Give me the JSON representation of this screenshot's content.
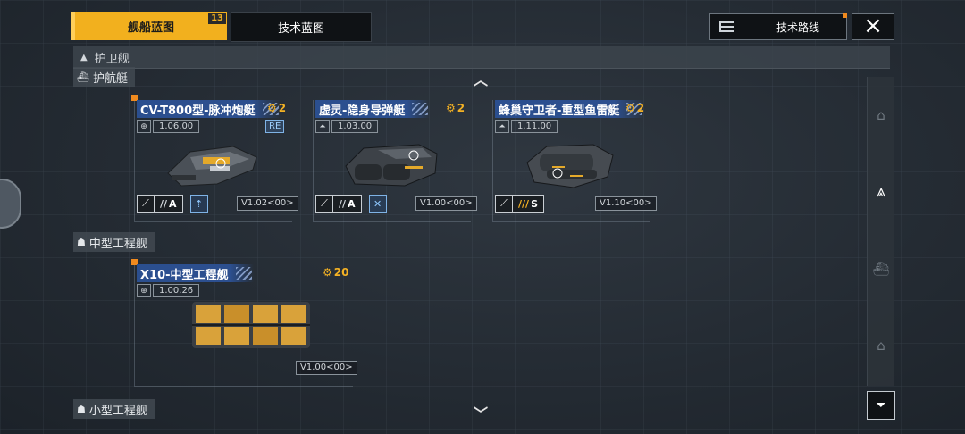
{
  "tabs": {
    "ship_blueprint": "舰船蓝图",
    "ship_blueprint_badge": "13",
    "tech_blueprint": "技术蓝图"
  },
  "top_right": {
    "tech_route": "技术路线",
    "close_icon": "×"
  },
  "category": {
    "title": "护卫舰"
  },
  "subcategories": {
    "escort": "护航艇",
    "medium_engineering": "中型工程舰",
    "small_engineering": "小型工程舰"
  },
  "ships": [
    {
      "name": "CV-T800型-脉冲炮艇",
      "cost": "2",
      "version": "1.06.00",
      "badge": "RE",
      "grade_prefix": "//",
      "grade": "A",
      "vtag": "V1.02<00>"
    },
    {
      "name": "虚灵-隐身导弹艇",
      "cost": "2",
      "version": "1.03.00",
      "grade_prefix": "//",
      "grade": "A",
      "vtag": "V1.00<00>"
    },
    {
      "name": "蜂巢守卫者-重型鱼雷艇",
      "cost": "2",
      "version": "1.11.00",
      "grade_prefix": "///",
      "grade": "S",
      "vtag": "V1.10<00>"
    },
    {
      "name": "X10-中型工程舰",
      "cost": "20",
      "version": "1.00.26",
      "vtag": "V1.00<00>"
    }
  ],
  "colors": {
    "accent": "#f2b01e",
    "title_bar": "#2b4f8f",
    "marker": "#f08a1e"
  }
}
